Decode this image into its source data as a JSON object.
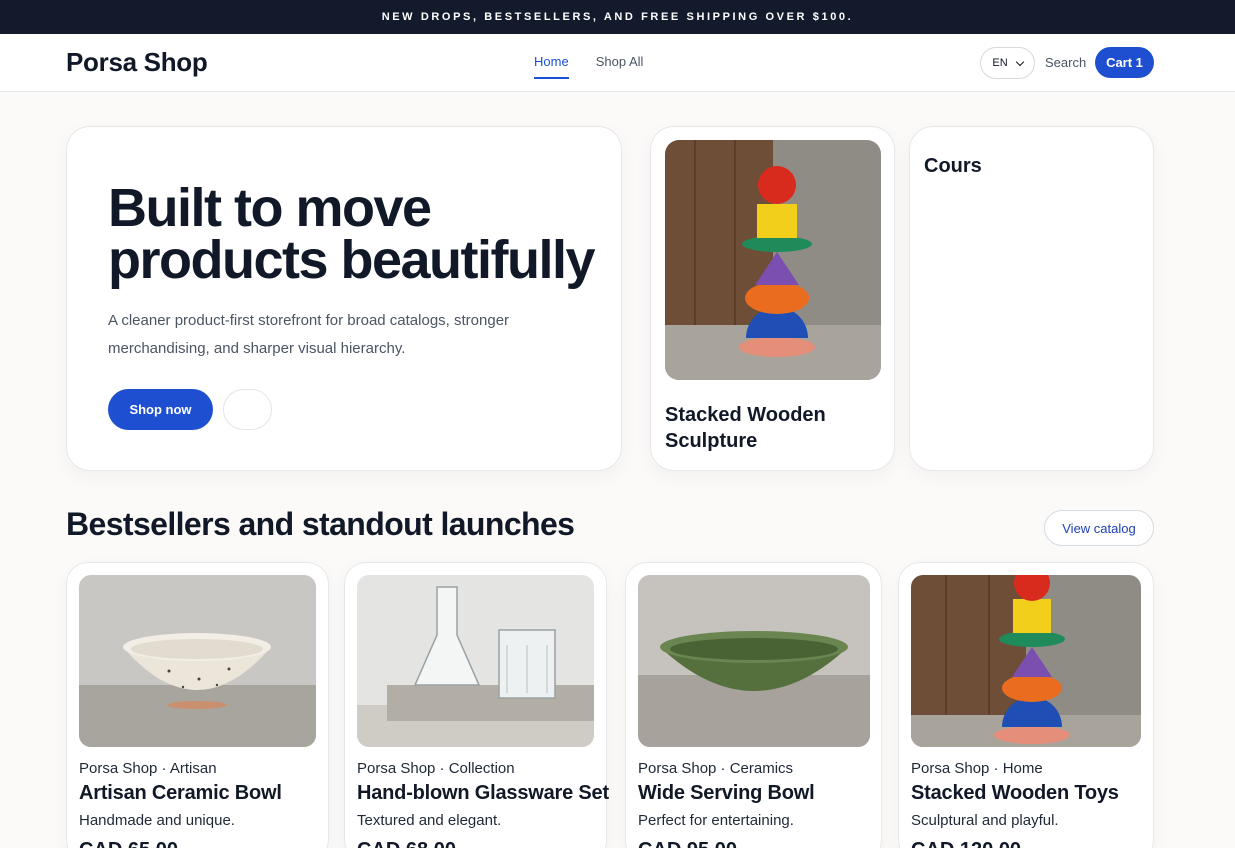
{
  "announcement": "NEW DROPS, BESTSELLERS, AND FREE SHIPPING OVER $100.",
  "header": {
    "brand": "Porsa Shop",
    "nav": [
      {
        "label": "Home",
        "active": true
      },
      {
        "label": "Shop All",
        "active": false
      }
    ],
    "language": "EN",
    "search_label": "Search",
    "cart_label": "Cart 1"
  },
  "hero": {
    "title": "Built to move products beautifully",
    "subtitle": "A cleaner product-first storefront for broad catalogs, stronger merchandising, and sharper visual hierarchy.",
    "primary_cta": "Shop now"
  },
  "feature_card": {
    "title": "Stacked Wooden Sculpture",
    "image": "stacked-toy-image"
  },
  "side_card": {
    "title": "Cours"
  },
  "bestsellers": {
    "title": "Bestsellers and standout launches",
    "view_catalog": "View catalog",
    "products": [
      {
        "meta": "Porsa Shop · Artisan",
        "name": "Artisan Ceramic Bowl",
        "desc": "Handmade and unique.",
        "price": "CAD 65.00",
        "image": "speckled-bowl-image"
      },
      {
        "meta": "Porsa Shop · Collection",
        "name": "Hand-blown Glassware Set",
        "desc": "Textured and elegant.",
        "price": "CAD 68.00",
        "image": "glassware-image"
      },
      {
        "meta": "Porsa Shop · Ceramics",
        "name": "Wide Serving Bowl",
        "desc": "Perfect for entertaining.",
        "price": "CAD 95.00",
        "image": "green-bowl-image"
      },
      {
        "meta": "Porsa Shop · Home",
        "name": "Stacked Wooden Toys",
        "desc": "Sculptural and playful.",
        "price": "CAD 120.00",
        "image": "stacked-toy-image"
      }
    ]
  },
  "colors": {
    "accent": "#1f4fd1",
    "announcement_bg": "#121a2c",
    "page_bg": "#fbfaf8"
  }
}
